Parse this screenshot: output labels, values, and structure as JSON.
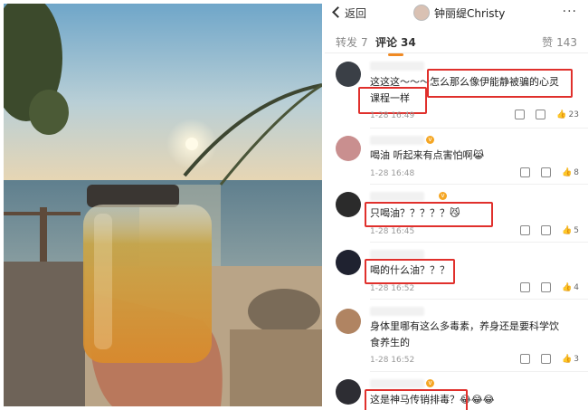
{
  "header": {
    "back_label": "返回",
    "author_name": "钟丽缇Christy",
    "more_glyph": "···"
  },
  "tabs": {
    "reposts_label": "转发",
    "reposts_count": "7",
    "comments_label": "评论",
    "comments_count": "34",
    "likes_label": "赞",
    "likes_count": "143"
  },
  "comments": [
    {
      "text_a": "这这这～～～",
      "text_b": "怎么那么像伊能静被骗的心灵",
      "text_c": "课程一样",
      "time": "1-28 16:49",
      "likes": "23"
    },
    {
      "text": "喝油 听起来有点害怕啊😹",
      "time": "1-28 16:48",
      "likes": "8"
    },
    {
      "text": "只喝油？？？？？😼",
      "time": "1-28 16:45",
      "likes": "5"
    },
    {
      "text": "喝的什么油？？？",
      "time": "1-28 16:52",
      "likes": "4"
    },
    {
      "text_a": "身体里哪有这么多毒素，养身还是要科学饮",
      "text_b": "食养生的",
      "time": "1-28 16:52",
      "likes": "3"
    },
    {
      "text": "这是神马传销排毒？😂😂😂"
    }
  ],
  "colors": {
    "highlight": "#e0302c",
    "tab_indicator": "#f08a24"
  }
}
